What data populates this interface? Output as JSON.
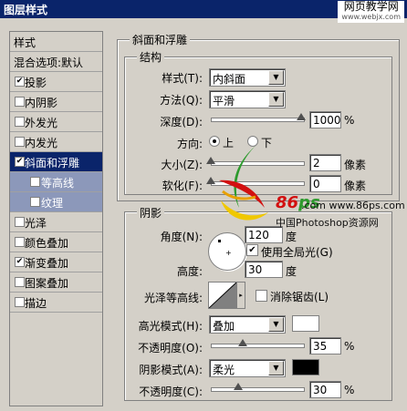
{
  "window": {
    "title": "图层样式"
  },
  "watermark_top": {
    "line1": "网页教学网",
    "line2": "www.webjx.com"
  },
  "left_panel": {
    "items": [
      {
        "label": "样式",
        "checkbox": false,
        "checked": false,
        "state": "plain"
      },
      {
        "label": "混合选项:默认",
        "checkbox": false,
        "checked": false,
        "state": "plain"
      },
      {
        "label": "投影",
        "checkbox": true,
        "checked": true,
        "state": "normal"
      },
      {
        "label": "内阴影",
        "checkbox": true,
        "checked": false,
        "state": "normal"
      },
      {
        "label": "外发光",
        "checkbox": true,
        "checked": false,
        "state": "normal"
      },
      {
        "label": "内发光",
        "checkbox": true,
        "checked": false,
        "state": "normal"
      },
      {
        "label": "斜面和浮雕",
        "checkbox": true,
        "checked": true,
        "state": "selected"
      },
      {
        "label": "等高线",
        "checkbox": true,
        "checked": false,
        "state": "sub"
      },
      {
        "label": "纹理",
        "checkbox": true,
        "checked": false,
        "state": "sub"
      },
      {
        "label": "光泽",
        "checkbox": true,
        "checked": false,
        "state": "normal"
      },
      {
        "label": "颜色叠加",
        "checkbox": true,
        "checked": false,
        "state": "normal"
      },
      {
        "label": "渐变叠加",
        "checkbox": true,
        "checked": true,
        "state": "normal"
      },
      {
        "label": "图案叠加",
        "checkbox": true,
        "checked": false,
        "state": "normal"
      },
      {
        "label": "描边",
        "checkbox": true,
        "checked": false,
        "state": "normal"
      }
    ]
  },
  "bevel": {
    "section_title": "斜面和浮雕",
    "structure_title": "结构",
    "style": {
      "label": "样式(T):",
      "value": "内斜面"
    },
    "technique": {
      "label": "方法(Q):",
      "value": "平滑"
    },
    "depth": {
      "label": "深度(D):",
      "value": "1000",
      "unit": "%",
      "level": 1.0
    },
    "direction": {
      "label": "方向:",
      "up": "上",
      "down": "下",
      "selected": "up"
    },
    "size": {
      "label": "大小(Z):",
      "value": "2",
      "unit": "像素",
      "level": 0.0
    },
    "soften": {
      "label": "软化(F):",
      "value": "0",
      "unit": "像素",
      "level": 0.0
    }
  },
  "shading": {
    "title": "阴影",
    "angle": {
      "label": "角度(N):",
      "value": "120",
      "unit": "度"
    },
    "global_light": {
      "label": "使用全局光(G)",
      "checked": true
    },
    "altitude": {
      "label": "高度:",
      "value": "30",
      "unit": "度"
    },
    "gloss_contour": {
      "label": "光泽等高线:"
    },
    "anti_aliased": {
      "label": "消除锯齿(L)",
      "checked": false
    },
    "highlight_mode": {
      "label": "高光模式(H):",
      "value": "叠加",
      "color": "#ffffff"
    },
    "highlight_opacity": {
      "label": "不透明度(O):",
      "value": "35",
      "unit": "%",
      "level": 0.35
    },
    "shadow_mode": {
      "label": "阴影模式(A):",
      "value": "柔光",
      "color": "#000000"
    },
    "shadow_opacity": {
      "label": "不透明度(C):",
      "value": "30",
      "unit": "%",
      "level": 0.3
    }
  },
  "watermark_86": {
    "brand": "86",
    "brand2": "ps",
    "url": ".com www.86ps.com",
    "cn": "中国Photoshop资源网"
  },
  "colors": {
    "title_bg": "#0a246a",
    "selected_bg": "#0a246a",
    "sub_bg": "#8c98ba",
    "dialog_bg": "#d4d0c8"
  }
}
